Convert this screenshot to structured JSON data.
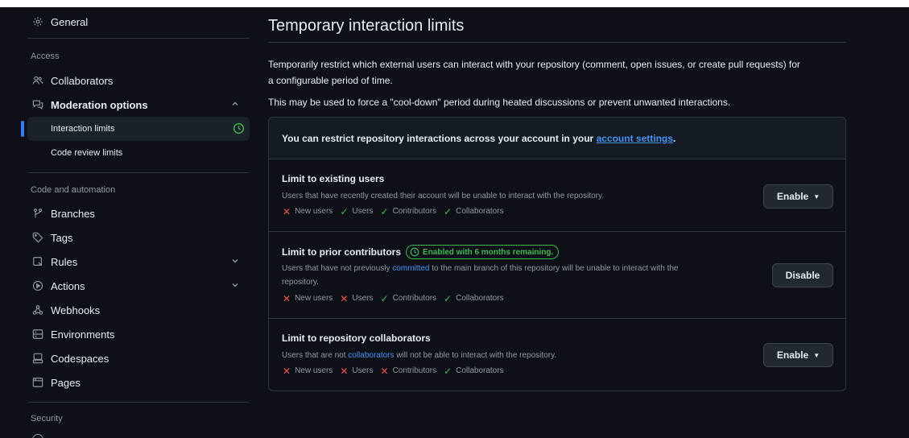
{
  "sidebar": {
    "general": "General",
    "access_heading": "Access",
    "collaborators": "Collaborators",
    "moderation": "Moderation options",
    "interaction_limits": "Interaction limits",
    "code_review_limits": "Code review limits",
    "code_heading": "Code and automation",
    "branches": "Branches",
    "tags": "Tags",
    "rules": "Rules",
    "actions": "Actions",
    "webhooks": "Webhooks",
    "environments": "Environments",
    "codespaces": "Codespaces",
    "pages": "Pages",
    "security_heading": "Security"
  },
  "main": {
    "title": "Temporary interaction limits",
    "desc1": "Temporarily restrict which external users can interact with your repository (comment, open issues, or create pull requests) for",
    "desc1b": "a configurable period of time.",
    "desc2": "This may be used to force a \"cool-down\" period during heated discussions or prevent unwanted interactions.",
    "box_head_prefix": "You can restrict repository interactions across your account in your ",
    "box_head_link": "account settings",
    "box_head_suffix": "."
  },
  "limits": [
    {
      "title": "Limit to existing users",
      "desc": "Users that have recently created their account will be unable to interact with the repository.",
      "button": "Enable",
      "perms": [
        {
          "label": "New users",
          "allowed": "✕"
        },
        {
          "label": "Users",
          "allowed": "✓"
        },
        {
          "label": "Contributors",
          "allowed": "✓"
        },
        {
          "label": "Collaborators",
          "allowed": "✓"
        }
      ]
    },
    {
      "title": "Limit to prior contributors",
      "badge": "Enabled with 6 months remaining.",
      "desc_pre": "Users that have not previously ",
      "desc_link": "committed",
      "desc_post": " to the main branch of this repository will be unable to interact with the",
      "desc_line2": "repository.",
      "button": "Disable",
      "perms": [
        {
          "label": "New users",
          "allowed": "✕"
        },
        {
          "label": "Users",
          "allowed": "✕"
        },
        {
          "label": "Contributors",
          "allowed": "✓"
        },
        {
          "label": "Collaborators",
          "allowed": "✓"
        }
      ]
    },
    {
      "title": "Limit to repository collaborators",
      "desc_pre": "Users that are not ",
      "desc_link": "collaborators",
      "desc_post": " will not be able to interact with the repository.",
      "button": "Enable",
      "perms": [
        {
          "label": "New users",
          "allowed": "✕"
        },
        {
          "label": "Users",
          "allowed": "✕"
        },
        {
          "label": "Contributors",
          "allowed": "✕"
        },
        {
          "label": "Collaborators",
          "allowed": "✓"
        }
      ]
    }
  ],
  "colors": {
    "background": "#0d1117",
    "accent_blue": "#2f81f7",
    "success_green": "#3fb950",
    "danger_red": "#f85149"
  }
}
